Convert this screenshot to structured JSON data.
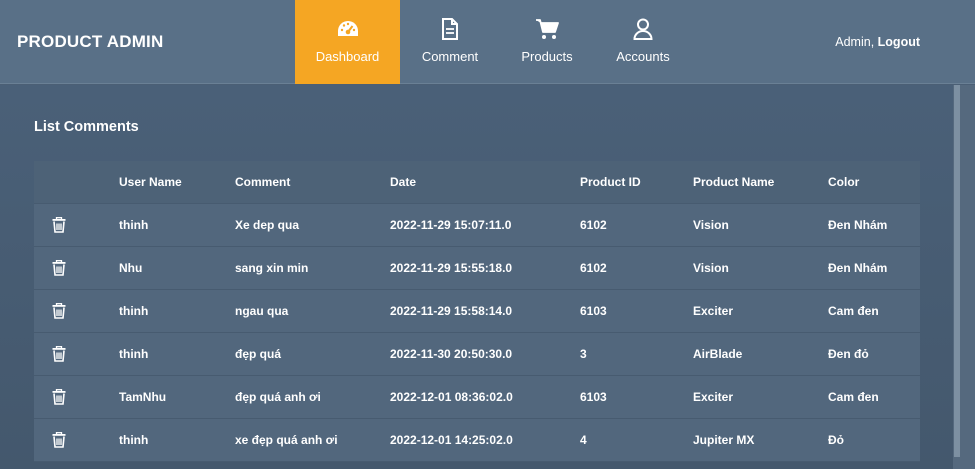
{
  "header": {
    "brand": "PRODUCT ADMIN",
    "nav": [
      {
        "label": "Dashboard",
        "icon": "speedometer-icon",
        "active": true
      },
      {
        "label": "Comment",
        "icon": "document-icon",
        "active": false
      },
      {
        "label": "Products",
        "icon": "cart-icon",
        "active": false
      },
      {
        "label": "Accounts",
        "icon": "user-icon",
        "active": false
      }
    ],
    "user": {
      "name": "Admin,",
      "logout": "Logout"
    }
  },
  "main": {
    "title": "List Comments",
    "columns": [
      "User Name",
      "Comment",
      "Date",
      "Product ID",
      "Product Name",
      "Color"
    ],
    "rows": [
      {
        "user": "thinh",
        "comment": "Xe dep qua",
        "date": "2022-11-29 15:07:11.0",
        "pid": "6102",
        "pname": "Vision",
        "color": "Đen Nhám"
      },
      {
        "user": "Nhu",
        "comment": "sang xin min",
        "date": "2022-11-29 15:55:18.0",
        "pid": "6102",
        "pname": "Vision",
        "color": "Đen Nhám"
      },
      {
        "user": "thinh",
        "comment": "ngau qua",
        "date": "2022-11-29 15:58:14.0",
        "pid": "6103",
        "pname": "Exciter",
        "color": "Cam đen"
      },
      {
        "user": "thinh",
        "comment": "đẹp quá",
        "date": "2022-11-30 20:50:30.0",
        "pid": "3",
        "pname": "AirBlade",
        "color": "Đen đỏ"
      },
      {
        "user": "TamNhu",
        "comment": "đẹp quá anh ơi",
        "date": "2022-12-01 08:36:02.0",
        "pid": "6103",
        "pname": "Exciter",
        "color": "Cam đen"
      },
      {
        "user": "thinh",
        "comment": "xe đẹp quá anh ơi",
        "date": "2022-12-01 14:25:02.0",
        "pid": "4",
        "pname": "Jupiter MX",
        "color": "Đỏ"
      }
    ]
  },
  "colors": {
    "accent": "#f5a623",
    "navbar": "#597087",
    "panel": "#4a6078",
    "row": "#52677d"
  }
}
